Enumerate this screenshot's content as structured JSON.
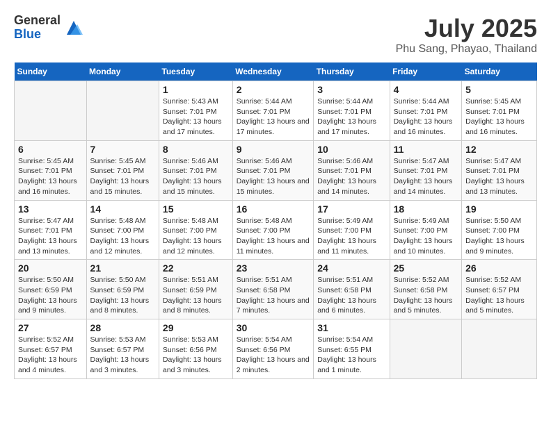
{
  "logo": {
    "general": "General",
    "blue": "Blue"
  },
  "title": "July 2025",
  "subtitle": "Phu Sang, Phayao, Thailand",
  "calendar": {
    "headers": [
      "Sunday",
      "Monday",
      "Tuesday",
      "Wednesday",
      "Thursday",
      "Friday",
      "Saturday"
    ],
    "weeks": [
      [
        {
          "day": "",
          "info": ""
        },
        {
          "day": "",
          "info": ""
        },
        {
          "day": "1",
          "sunrise": "Sunrise: 5:43 AM",
          "sunset": "Sunset: 7:01 PM",
          "daylight": "Daylight: 13 hours and 17 minutes."
        },
        {
          "day": "2",
          "sunrise": "Sunrise: 5:44 AM",
          "sunset": "Sunset: 7:01 PM",
          "daylight": "Daylight: 13 hours and 17 minutes."
        },
        {
          "day": "3",
          "sunrise": "Sunrise: 5:44 AM",
          "sunset": "Sunset: 7:01 PM",
          "daylight": "Daylight: 13 hours and 17 minutes."
        },
        {
          "day": "4",
          "sunrise": "Sunrise: 5:44 AM",
          "sunset": "Sunset: 7:01 PM",
          "daylight": "Daylight: 13 hours and 16 minutes."
        },
        {
          "day": "5",
          "sunrise": "Sunrise: 5:45 AM",
          "sunset": "Sunset: 7:01 PM",
          "daylight": "Daylight: 13 hours and 16 minutes."
        }
      ],
      [
        {
          "day": "6",
          "sunrise": "Sunrise: 5:45 AM",
          "sunset": "Sunset: 7:01 PM",
          "daylight": "Daylight: 13 hours and 16 minutes."
        },
        {
          "day": "7",
          "sunrise": "Sunrise: 5:45 AM",
          "sunset": "Sunset: 7:01 PM",
          "daylight": "Daylight: 13 hours and 15 minutes."
        },
        {
          "day": "8",
          "sunrise": "Sunrise: 5:46 AM",
          "sunset": "Sunset: 7:01 PM",
          "daylight": "Daylight: 13 hours and 15 minutes."
        },
        {
          "day": "9",
          "sunrise": "Sunrise: 5:46 AM",
          "sunset": "Sunset: 7:01 PM",
          "daylight": "Daylight: 13 hours and 15 minutes."
        },
        {
          "day": "10",
          "sunrise": "Sunrise: 5:46 AM",
          "sunset": "Sunset: 7:01 PM",
          "daylight": "Daylight: 13 hours and 14 minutes."
        },
        {
          "day": "11",
          "sunrise": "Sunrise: 5:47 AM",
          "sunset": "Sunset: 7:01 PM",
          "daylight": "Daylight: 13 hours and 14 minutes."
        },
        {
          "day": "12",
          "sunrise": "Sunrise: 5:47 AM",
          "sunset": "Sunset: 7:01 PM",
          "daylight": "Daylight: 13 hours and 13 minutes."
        }
      ],
      [
        {
          "day": "13",
          "sunrise": "Sunrise: 5:47 AM",
          "sunset": "Sunset: 7:01 PM",
          "daylight": "Daylight: 13 hours and 13 minutes."
        },
        {
          "day": "14",
          "sunrise": "Sunrise: 5:48 AM",
          "sunset": "Sunset: 7:00 PM",
          "daylight": "Daylight: 13 hours and 12 minutes."
        },
        {
          "day": "15",
          "sunrise": "Sunrise: 5:48 AM",
          "sunset": "Sunset: 7:00 PM",
          "daylight": "Daylight: 13 hours and 12 minutes."
        },
        {
          "day": "16",
          "sunrise": "Sunrise: 5:48 AM",
          "sunset": "Sunset: 7:00 PM",
          "daylight": "Daylight: 13 hours and 11 minutes."
        },
        {
          "day": "17",
          "sunrise": "Sunrise: 5:49 AM",
          "sunset": "Sunset: 7:00 PM",
          "daylight": "Daylight: 13 hours and 11 minutes."
        },
        {
          "day": "18",
          "sunrise": "Sunrise: 5:49 AM",
          "sunset": "Sunset: 7:00 PM",
          "daylight": "Daylight: 13 hours and 10 minutes."
        },
        {
          "day": "19",
          "sunrise": "Sunrise: 5:50 AM",
          "sunset": "Sunset: 7:00 PM",
          "daylight": "Daylight: 13 hours and 9 minutes."
        }
      ],
      [
        {
          "day": "20",
          "sunrise": "Sunrise: 5:50 AM",
          "sunset": "Sunset: 6:59 PM",
          "daylight": "Daylight: 13 hours and 9 minutes."
        },
        {
          "day": "21",
          "sunrise": "Sunrise: 5:50 AM",
          "sunset": "Sunset: 6:59 PM",
          "daylight": "Daylight: 13 hours and 8 minutes."
        },
        {
          "day": "22",
          "sunrise": "Sunrise: 5:51 AM",
          "sunset": "Sunset: 6:59 PM",
          "daylight": "Daylight: 13 hours and 8 minutes."
        },
        {
          "day": "23",
          "sunrise": "Sunrise: 5:51 AM",
          "sunset": "Sunset: 6:58 PM",
          "daylight": "Daylight: 13 hours and 7 minutes."
        },
        {
          "day": "24",
          "sunrise": "Sunrise: 5:51 AM",
          "sunset": "Sunset: 6:58 PM",
          "daylight": "Daylight: 13 hours and 6 minutes."
        },
        {
          "day": "25",
          "sunrise": "Sunrise: 5:52 AM",
          "sunset": "Sunset: 6:58 PM",
          "daylight": "Daylight: 13 hours and 5 minutes."
        },
        {
          "day": "26",
          "sunrise": "Sunrise: 5:52 AM",
          "sunset": "Sunset: 6:57 PM",
          "daylight": "Daylight: 13 hours and 5 minutes."
        }
      ],
      [
        {
          "day": "27",
          "sunrise": "Sunrise: 5:52 AM",
          "sunset": "Sunset: 6:57 PM",
          "daylight": "Daylight: 13 hours and 4 minutes."
        },
        {
          "day": "28",
          "sunrise": "Sunrise: 5:53 AM",
          "sunset": "Sunset: 6:57 PM",
          "daylight": "Daylight: 13 hours and 3 minutes."
        },
        {
          "day": "29",
          "sunrise": "Sunrise: 5:53 AM",
          "sunset": "Sunset: 6:56 PM",
          "daylight": "Daylight: 13 hours and 3 minutes."
        },
        {
          "day": "30",
          "sunrise": "Sunrise: 5:54 AM",
          "sunset": "Sunset: 6:56 PM",
          "daylight": "Daylight: 13 hours and 2 minutes."
        },
        {
          "day": "31",
          "sunrise": "Sunrise: 5:54 AM",
          "sunset": "Sunset: 6:55 PM",
          "daylight": "Daylight: 13 hours and 1 minute."
        },
        {
          "day": "",
          "info": ""
        },
        {
          "day": "",
          "info": ""
        }
      ]
    ]
  }
}
